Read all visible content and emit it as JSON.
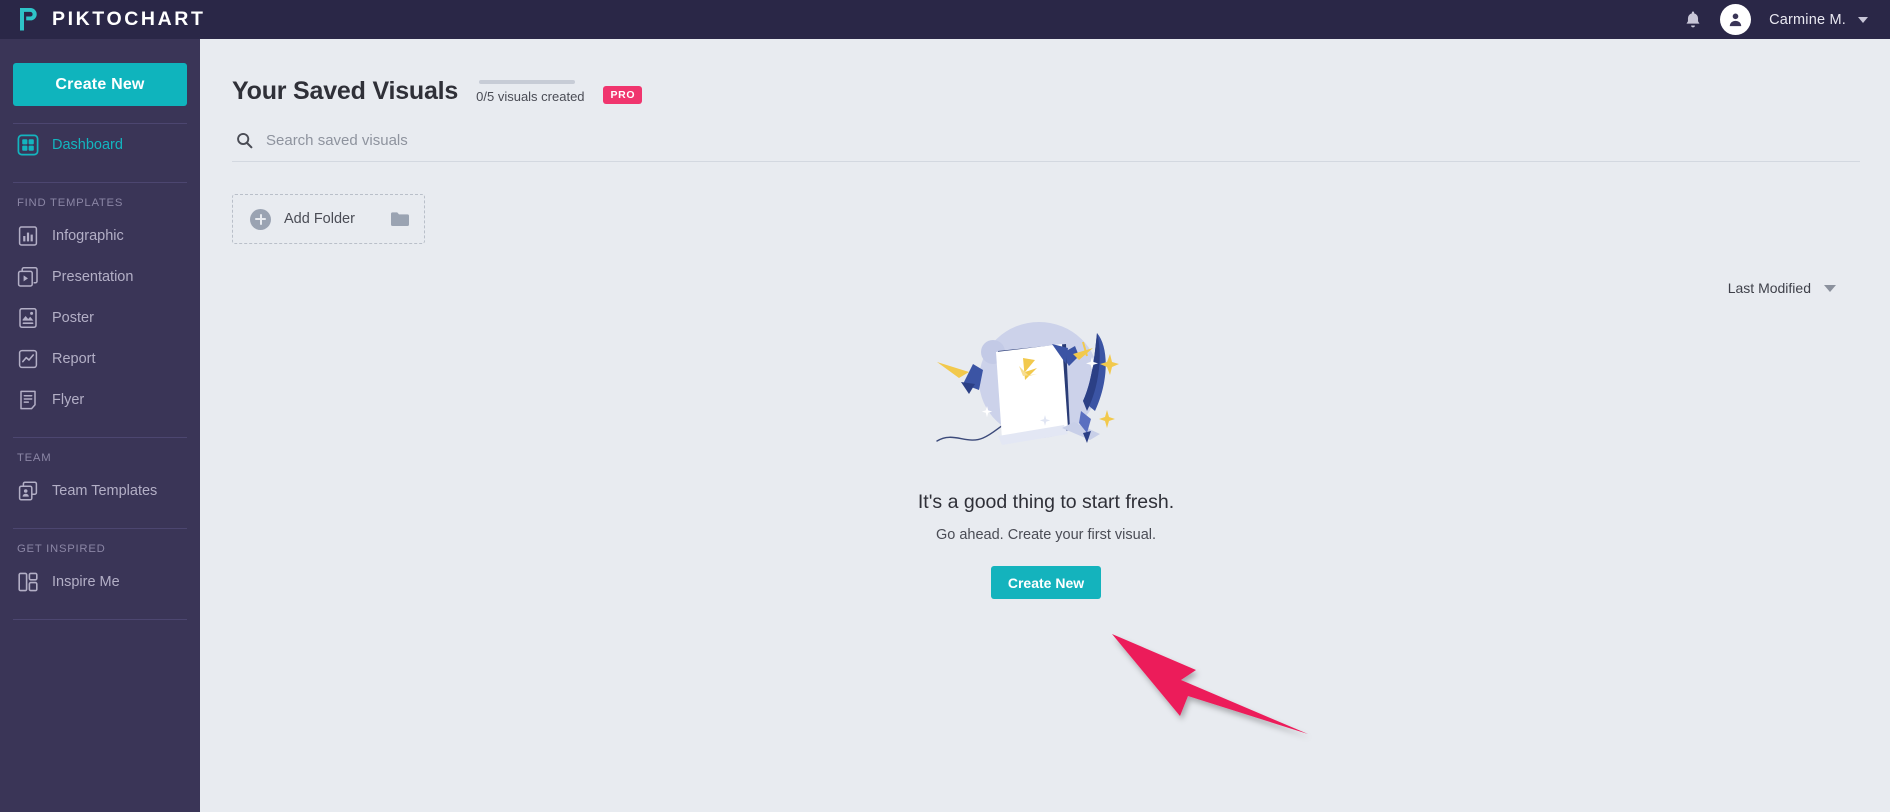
{
  "topbar": {
    "brand_name": "PIKTOCHART",
    "logo_icon": "piktochart-p-logo",
    "notification_icon": "bell-icon",
    "avatar_icon": "user-avatar-icon",
    "user_name": "Carmine M.",
    "user_menu_icon": "chevron-down-icon",
    "bg_color": "#2a2747"
  },
  "sidebar": {
    "bg_color": "#3a3557",
    "create_button": {
      "label": "Create New",
      "color": "#0fb4bd"
    },
    "dashboard": {
      "label": "Dashboard",
      "icon": "grid-dashboard-icon",
      "active": true,
      "active_color": "#13b5bf"
    },
    "sections": [
      {
        "label": "FIND TEMPLATES",
        "items": [
          {
            "label": "Infographic",
            "icon": "bar-chart-icon"
          },
          {
            "label": "Presentation",
            "icon": "presentation-slides-icon"
          },
          {
            "label": "Poster",
            "icon": "image-poster-icon"
          },
          {
            "label": "Report",
            "icon": "line-graph-report-icon"
          },
          {
            "label": "Flyer",
            "icon": "document-flyer-icon"
          }
        ]
      },
      {
        "label": "TEAM",
        "items": [
          {
            "label": "Team Templates",
            "icon": "team-templates-icon"
          }
        ]
      },
      {
        "label": "GET INSPIRED",
        "items": [
          {
            "label": "Inspire Me",
            "icon": "layout-blocks-icon"
          }
        ]
      }
    ]
  },
  "main": {
    "page_title": "Your Saved Visuals",
    "quota": {
      "text": "0/5 visuals created",
      "used": 0,
      "total": 5,
      "percent": 0
    },
    "pro_badge": {
      "label": "PRO",
      "color": "#f0356e"
    },
    "search": {
      "placeholder": "Search saved visuals",
      "value": "",
      "icon": "search-icon"
    },
    "add_folder": {
      "label": "Add Folder",
      "plus_icon": "plus-circle-icon",
      "folder_icon": "folder-icon"
    },
    "sort": {
      "label": "Last Modified",
      "caret_icon": "caret-down-icon"
    },
    "empty_state": {
      "illustration": "blank-page-with-quill-illustration",
      "title": "It's a good thing to start fresh.",
      "subtitle": "Go ahead. Create your first visual.",
      "cta_label": "Create New",
      "cta_color": "#14b3bd"
    },
    "annotation": {
      "arrow_icon": "pointer-arrow-annotation",
      "color": "#ec1b5a"
    }
  }
}
